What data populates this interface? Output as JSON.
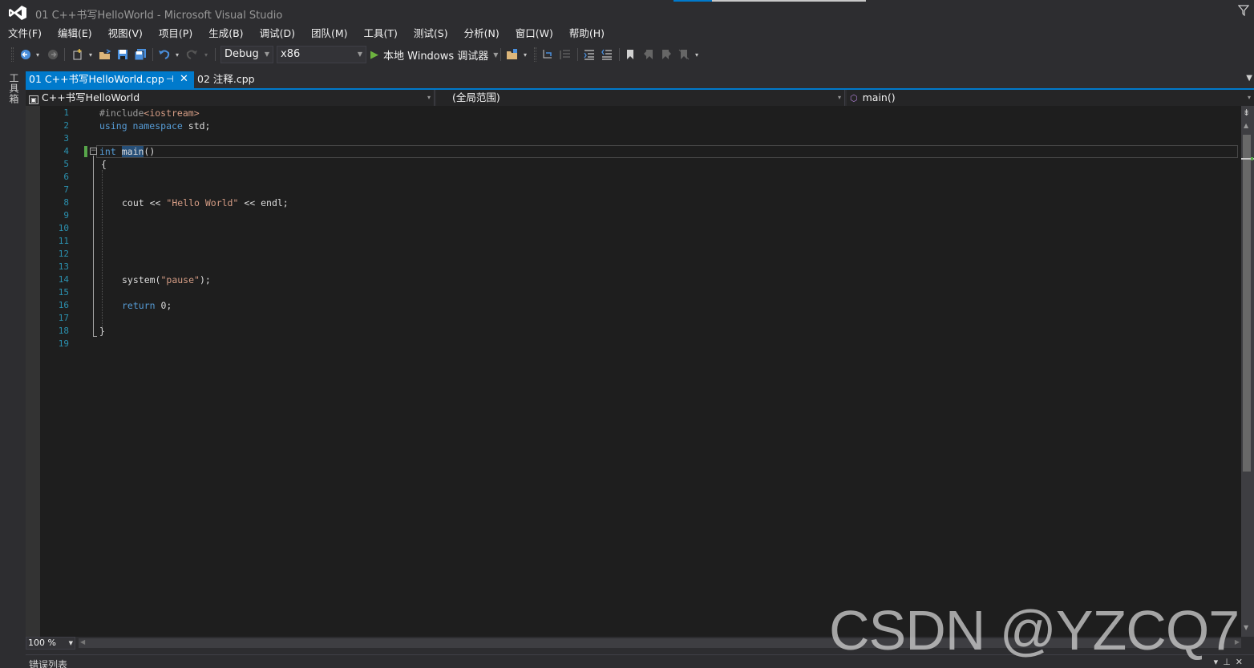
{
  "window": {
    "title": "01 C++书写HelloWorld - Microsoft Visual Studio"
  },
  "menu": [
    "文件(F)",
    "编辑(E)",
    "视图(V)",
    "项目(P)",
    "生成(B)",
    "调试(D)",
    "团队(M)",
    "工具(T)",
    "测试(S)",
    "分析(N)",
    "窗口(W)",
    "帮助(H)"
  ],
  "toolbar": {
    "configuration": "Debug",
    "platform": "x86",
    "start_label": "本地 Windows 调试器"
  },
  "toolbox": {
    "label": "工具箱"
  },
  "tabs": [
    {
      "label": "01 C++书写HelloWorld.cpp",
      "active": true
    },
    {
      "label": "02 注释.cpp",
      "active": false
    }
  ],
  "navbar": {
    "project": "C++书写HelloWorld",
    "scope": "(全局范围)",
    "member": "main()"
  },
  "code": {
    "line_numbers": [
      "1",
      "2",
      "3",
      "4",
      "5",
      "6",
      "7",
      "8",
      "9",
      "10",
      "11",
      "12",
      "13",
      "14",
      "15",
      "16",
      "17",
      "18",
      "19"
    ],
    "include_directive": "#include",
    "include_target": "<iostream>",
    "using_kw": "using namespace",
    "using_rest": " std;",
    "int_kw": "int",
    "main_name": "main",
    "main_parens": "()",
    "open_brace": "{",
    "cout_pre": "cout << ",
    "cout_str": "\"Hello World\"",
    "cout_post": " << endl;",
    "system_pre": "system(",
    "system_str": "\"pause\"",
    "system_post": ");",
    "return_kw": "return",
    "return_rest": " 0;",
    "close_brace": "}"
  },
  "zoom": {
    "value": "100 %"
  },
  "error_list": {
    "title": "错误列表"
  },
  "watermark": "CSDN @YZCQ7",
  "colors": {
    "accent": "#007acc",
    "keyword": "#569cd6",
    "string": "#d69d85",
    "line_number": "#2b91af",
    "editor_bg": "#1e1e1e"
  }
}
